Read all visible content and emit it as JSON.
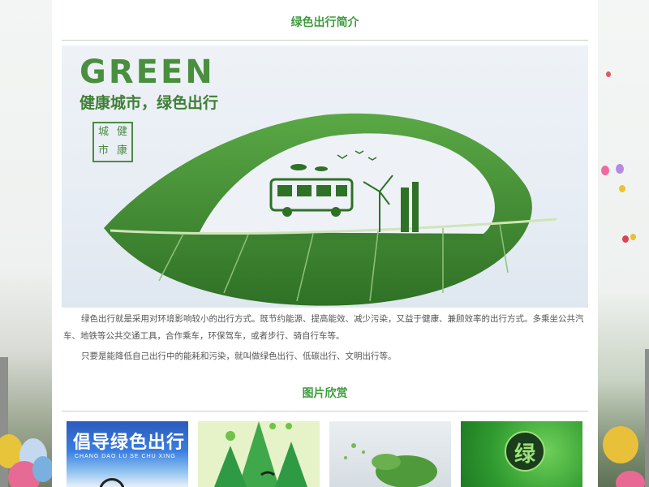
{
  "intro": {
    "title": "绿色出行简介",
    "hero": {
      "headline": "GREEN",
      "subline": "健康城市，绿色出行",
      "seal_chars": [
        "城",
        "健",
        "市",
        "康"
      ]
    },
    "paragraphs": [
      "绿色出行就是采用对环境影响较小的出行方式。既节约能源、提高能效、减少污染，又益于健康、兼顾效率的出行方式。多乘坐公共汽车、地铁等公共交通工具，合作乘车，环保驾车，或者步行、骑自行车等。",
      "只要是能降低自己出行中的能耗和污染，就叫做绿色出行、低碳出行、文明出行等。"
    ]
  },
  "gallery": {
    "title": "图片欣赏",
    "thumb1_text": "倡导绿色出行",
    "thumb1_pinyin": "CHANG DAO LU SE CHU XING",
    "thumb4_char": "绿"
  },
  "colors": {
    "title_green": "#3e9b3e",
    "leaf_green": "#3f8a32"
  }
}
